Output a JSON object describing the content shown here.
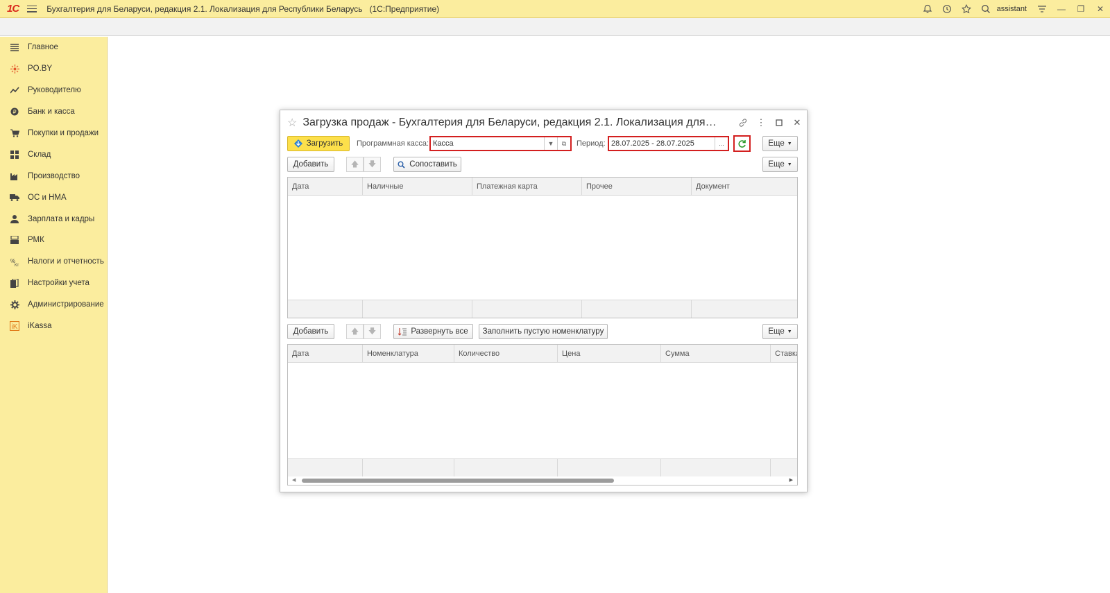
{
  "titlebar": {
    "logo": "1С",
    "title": "Бухгалтерия для Беларуси, редакция 2.1. Локализация для Республики Беларусь",
    "platform": "(1С:Предприятие)",
    "user": "assistant"
  },
  "sidebar": {
    "items": [
      {
        "label": "Главное",
        "icon": "menu-lines-icon"
      },
      {
        "label": "PO.BY",
        "icon": "po-by-icon"
      },
      {
        "label": "Руководителю",
        "icon": "trend-icon"
      },
      {
        "label": "Банк и касса",
        "icon": "coin-icon"
      },
      {
        "label": "Покупки и продажи",
        "icon": "cart-icon"
      },
      {
        "label": "Склад",
        "icon": "warehouse-icon"
      },
      {
        "label": "Производство",
        "icon": "factory-icon"
      },
      {
        "label": "ОС и НМА",
        "icon": "truck-icon"
      },
      {
        "label": "Зарплата и кадры",
        "icon": "person-icon"
      },
      {
        "label": "РМК",
        "icon": "register-icon"
      },
      {
        "label": "Налоги и отчетность",
        "icon": "tax-icon"
      },
      {
        "label": "Настройки учета",
        "icon": "books-icon"
      },
      {
        "label": "Администрирование",
        "icon": "gear-icon"
      },
      {
        "label": "iKassa",
        "icon": "ikassa-icon"
      }
    ]
  },
  "dialog": {
    "title": "Загрузка продаж - Бухгалтерия для Беларуси, редакция 2.1. Локализация для Ре...",
    "load_button": "Загрузить",
    "cash_label": "Программная касса:",
    "cash_value": "Касса",
    "period_label": "Период:",
    "period_value": "28.07.2025 - 28.07.2025",
    "period_picker": "...",
    "more_label": "Еще",
    "top_table": {
      "add_button": "Добавить",
      "match_button": "Сопоставить",
      "columns": [
        "Дата",
        "Наличные",
        "Платежная карта",
        "Прочее",
        "Документ"
      ]
    },
    "bottom_table": {
      "add_button": "Добавить",
      "expand_button": "Развернуть все",
      "fill_button": "Заполнить пустую номенклатуру",
      "columns": [
        "Дата",
        "Номенклатура",
        "Количество",
        "Цена",
        "Сумма",
        "Ставка"
      ]
    }
  },
  "colors": {
    "accent_yellow": "#fbed9e",
    "primary_button": "#fde04b",
    "highlight_red": "#d31f1f",
    "refresh_green": "#2e9b2e"
  }
}
